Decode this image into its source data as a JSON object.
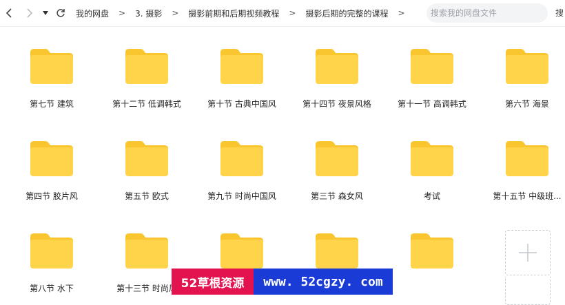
{
  "toolbar": {
    "breadcrumb": [
      "我的网盘",
      "3. 摄影",
      "摄影前期和后期视频教程",
      "摄影后期的完整的课程"
    ],
    "separator": ">",
    "search_placeholder": "搜索我的网盘文件",
    "search_button": "搜"
  },
  "folders": [
    "第七节 建筑",
    "第十二节 低调韩式",
    "第十节 古典中国风",
    "第十四节 夜景风格",
    "第十一节 高调韩式",
    "第六节 海景",
    "第四节 胶片风",
    "第五节 欧式",
    "第九节 时尚中国风",
    "第三节 森女风",
    "考试",
    "第十五节 中级班...",
    "第八节 水下",
    "第十三节 时尚风",
    "",
    "",
    ""
  ],
  "watermark": {
    "left": "52草根资源",
    "right": "www. 52cgzy. com"
  },
  "colors": {
    "folder": "#ffd44a",
    "folder_tab": "#f9c62f",
    "wm_left": "#e3134f",
    "wm_right": "#1a3bd6"
  }
}
